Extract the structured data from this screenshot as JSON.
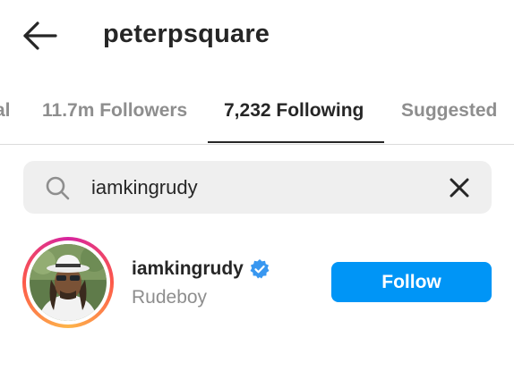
{
  "header": {
    "title": "peterpsquare",
    "back_icon": "arrow-left-icon"
  },
  "tabs": [
    {
      "label": "al",
      "active": false
    },
    {
      "label": "11.7m Followers",
      "active": false
    },
    {
      "label": "7,232 Following",
      "active": true
    },
    {
      "label": "Suggested",
      "active": false
    }
  ],
  "search": {
    "icon": "search-icon",
    "value": "iamkingrudy",
    "clear_icon": "close-icon"
  },
  "result": {
    "username": "iamkingrudy",
    "verified_icon": "verified-badge-icon",
    "full_name": "Rudeboy",
    "follow_label": "Follow"
  },
  "colors": {
    "accent": "#0095f6",
    "text": "#262626",
    "muted": "#8e8e8e",
    "search_bg": "#efefef",
    "verified": "#3897f0"
  }
}
